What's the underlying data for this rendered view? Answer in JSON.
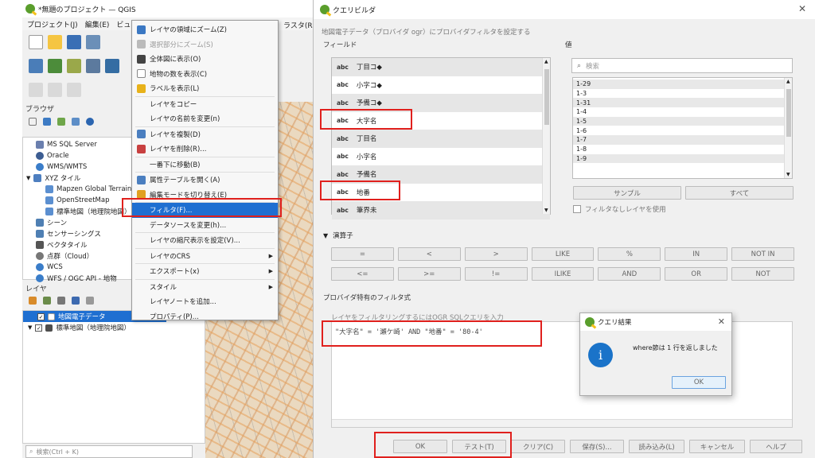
{
  "main_window": {
    "title": "*無題のプロジェクト — QGIS",
    "menu": [
      "プロジェクト(J)",
      "編集(E)",
      "ビュー(V)"
    ],
    "menu_right": "ラスタ(R)",
    "browser_title": "ブラウザ",
    "browser_items": [
      {
        "label": "MS SQL Server",
        "icon": "mssql-icon"
      },
      {
        "label": "Oracle",
        "icon": "oracle-icon"
      },
      {
        "label": "WMS/WMTS",
        "icon": "wms-icon"
      },
      {
        "label": "XYZ タイル",
        "icon": "xyz-icon"
      },
      {
        "label": "Mapzen Global Terrain",
        "icon": "tile-icon"
      },
      {
        "label": "OpenStreetMap",
        "icon": "tile-icon"
      },
      {
        "label": "標準地図（地理院地図）",
        "icon": "tile-icon"
      },
      {
        "label": "シーン",
        "icon": "scene-icon"
      },
      {
        "label": "センサーシングス",
        "icon": "sensor-icon"
      },
      {
        "label": "ベクタタイル",
        "icon": "vector-tile-icon"
      },
      {
        "label": "点群（Cloud）",
        "icon": "pointcloud-icon"
      },
      {
        "label": "WCS",
        "icon": "wcs-icon"
      },
      {
        "label": "WFS / OGC API - 地物",
        "icon": "wfs-icon"
      }
    ],
    "layers_title": "レイヤ",
    "layers": [
      {
        "label": "地図電子データ",
        "checked": "✓",
        "selected": true
      },
      {
        "label": "標準地図（地理院地図）",
        "checked": "✓",
        "selected": false
      }
    ],
    "search_placeholder": "検索(Ctrl + K)"
  },
  "context_menu": {
    "items": [
      {
        "label": "レイヤの領域にズーム(Z)",
        "icon": "zoom-layer-icon",
        "state": "normal"
      },
      {
        "label": "選択部分にズーム(S)",
        "icon": "zoom-selection-icon",
        "state": "disabled"
      },
      {
        "label": "全体図に表示(O)",
        "icon": "overview-icon",
        "state": "normal"
      },
      {
        "label": "地物の数を表示(C)",
        "icon": "checkbox-icon",
        "state": "normal"
      },
      {
        "label": "ラベルを表示(L)",
        "icon": "label-icon",
        "state": "normal"
      },
      {
        "label": "レイヤをコピー",
        "icon": "",
        "state": "normal"
      },
      {
        "label": "レイヤの名前を変更(n)",
        "icon": "",
        "state": "normal"
      },
      {
        "label": "レイヤを複製(D)",
        "icon": "duplicate-icon",
        "state": "normal"
      },
      {
        "label": "レイヤを削除(R)...",
        "icon": "remove-icon",
        "state": "normal"
      },
      {
        "label": "一番下に移動(B)",
        "icon": "",
        "state": "normal"
      },
      {
        "label": "属性テーブルを開く(A)",
        "icon": "table-icon",
        "state": "normal"
      },
      {
        "label": "編集モードを切り替え(E)",
        "icon": "pencil-icon",
        "state": "normal"
      },
      {
        "label": "フィルタ(F)...",
        "icon": "",
        "state": "selected"
      },
      {
        "label": "データソースを変更(h)...",
        "icon": "",
        "state": "normal"
      },
      {
        "label": "レイヤの縮尺表示を設定(V)...",
        "icon": "",
        "state": "normal"
      },
      {
        "label": "レイヤのCRS",
        "icon": "",
        "state": "submenu"
      },
      {
        "label": "エクスポート(x)",
        "icon": "",
        "state": "submenu"
      },
      {
        "label": "スタイル",
        "icon": "",
        "state": "submenu"
      },
      {
        "label": "レイヤノートを追加...",
        "icon": "",
        "state": "normal"
      },
      {
        "label": "プロパティ(P)...",
        "icon": "",
        "state": "normal"
      }
    ]
  },
  "query_builder": {
    "title": "クエリビルダ",
    "subtitle": "地図電子データ（プロバイダ ogr）にプロバイダフィルタを設定する",
    "fields_label": "フィールド",
    "fields": [
      {
        "type": "abc",
        "name": "丁目コ◆"
      },
      {
        "type": "abc",
        "name": "小字コ◆"
      },
      {
        "type": "abc",
        "name": "予備コ◆"
      },
      {
        "type": "abc",
        "name": "大字名"
      },
      {
        "type": "abc",
        "name": "丁目名"
      },
      {
        "type": "abc",
        "name": "小字名"
      },
      {
        "type": "abc",
        "name": "予備名"
      },
      {
        "type": "abc",
        "name": "地番"
      },
      {
        "type": "abc",
        "name": "筆界未"
      }
    ],
    "values_label": "値",
    "values_search_placeholder": "検索",
    "values": [
      "1-29",
      "1-3",
      "1-31",
      "1-4",
      "1-5",
      "1-6",
      "1-7",
      "1-8",
      "1-9"
    ],
    "sample_button": "サンプル",
    "all_button": "すべて",
    "use_unfiltered_label": "フィルタなしレイヤを使用",
    "operators_label": "演算子",
    "operators": [
      "=",
      "<",
      ">",
      "LIKE",
      "%",
      "IN",
      "NOT IN",
      "<=",
      ">=",
      "!=",
      "ILIKE",
      "AND",
      "OR",
      "NOT"
    ],
    "provider_filter_label": "プロバイダ特有のフィルタ式",
    "provider_filter_hint": "レイヤをフィルタリングするにはOGR SQLクエリを入力",
    "expression": "\"大字名\" = '瀬ケ崎' AND \"地番\" = '80-4'",
    "buttons": [
      "OK",
      "テスト(T)",
      "クリア(C)",
      "保存(S)...",
      "読み込み(L)",
      "キャンセル",
      "ヘルプ"
    ],
    "close_glyph": "✕"
  },
  "result_dialog": {
    "title": "クエリ結果",
    "message": "where節は 1 行を返しました",
    "info_glyph": "i",
    "ok": "OK",
    "close_glyph": "✕"
  },
  "colors": {
    "highlight_red": "#e0201d",
    "selection_blue": "#1f6fd1",
    "info_blue": "#1a73c9",
    "qgis_green": "#5a9e2c"
  }
}
